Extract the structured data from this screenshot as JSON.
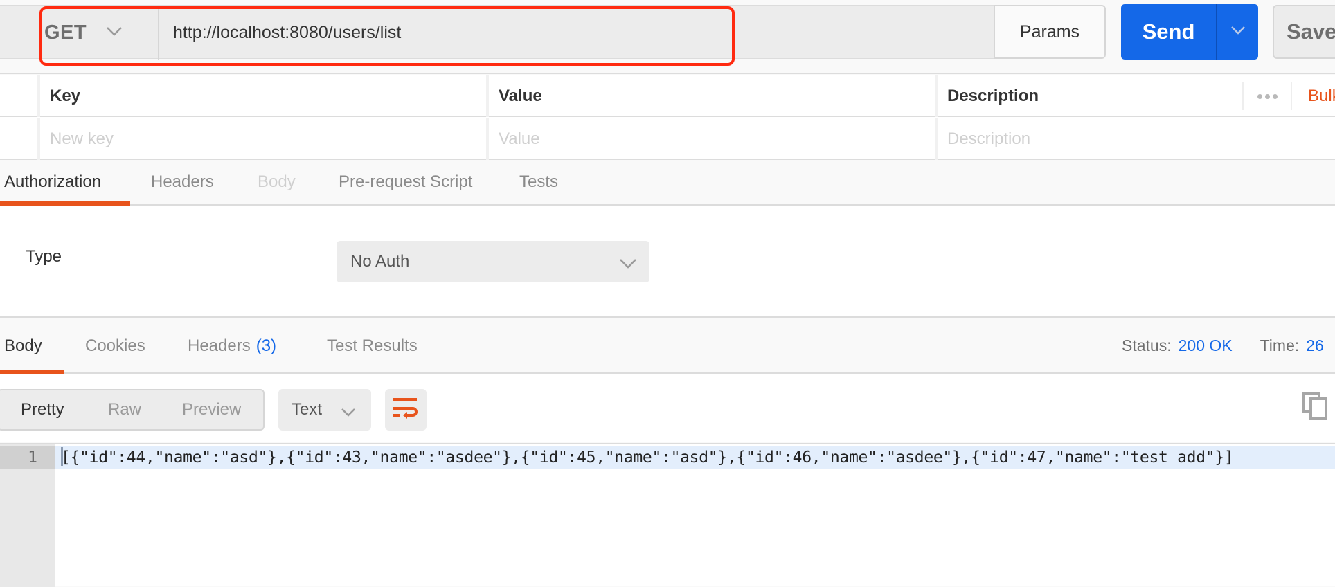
{
  "request": {
    "method": "GET",
    "url": "http://localhost:8080/users/list",
    "params_label": "Params",
    "send_label": "Send",
    "save_label": "Save"
  },
  "params_table": {
    "columns": [
      "Key",
      "Value",
      "Description"
    ],
    "placeholders": {
      "key": "New key",
      "value": "Value",
      "description": "Description"
    },
    "bulk_edit_label": "Bulk Edit"
  },
  "request_tabs": [
    {
      "label": "Authorization",
      "state": "active"
    },
    {
      "label": "Headers",
      "state": "normal"
    },
    {
      "label": "Body",
      "state": "disabled"
    },
    {
      "label": "Pre-request Script",
      "state": "normal"
    },
    {
      "label": "Tests",
      "state": "normal"
    }
  ],
  "auth": {
    "type_label": "Type",
    "type_value": "No Auth"
  },
  "response_tabs": [
    {
      "label": "Body",
      "state": "active"
    },
    {
      "label": "Cookies",
      "state": "normal"
    },
    {
      "label": "Headers",
      "count": "(3)",
      "state": "normal"
    },
    {
      "label": "Test Results",
      "state": "normal"
    }
  ],
  "response_status": {
    "status_label": "Status:",
    "status_value": "200 OK",
    "time_label": "Time:",
    "time_value": "26"
  },
  "response_toolbar": {
    "view_modes": [
      "Pretty",
      "Raw",
      "Preview"
    ],
    "active_view": "Pretty",
    "format": "Text",
    "wrap_icon": "wrap-lines-icon",
    "copy_icon": "copy-icon"
  },
  "response_body": {
    "lines": [
      {
        "number": "1",
        "text": "[{\"id\":44,\"name\":\"asd\"},{\"id\":43,\"name\":\"asdee\"},{\"id\":45,\"name\":\"asd\"},{\"id\":46,\"name\":\"asdee\"},{\"id\":47,\"name\":\"test add\"}]"
      }
    ]
  },
  "colors": {
    "accent_orange": "#e8541c",
    "primary_blue": "#1468e8",
    "annotation_red": "#ff2a10"
  }
}
